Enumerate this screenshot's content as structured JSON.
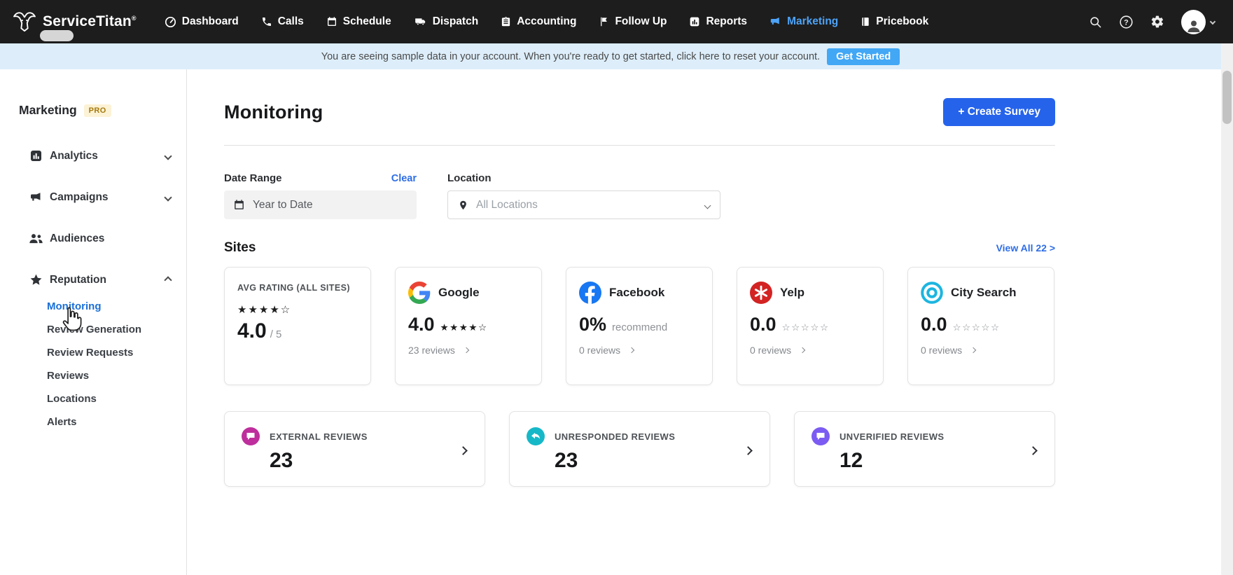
{
  "topbar": {
    "brand": "ServiceTitan",
    "brand_reg": "®",
    "nav": [
      {
        "label": "Dashboard",
        "active": false
      },
      {
        "label": "Calls",
        "active": false
      },
      {
        "label": "Schedule",
        "active": false
      },
      {
        "label": "Dispatch",
        "active": false
      },
      {
        "label": "Accounting",
        "active": false
      },
      {
        "label": "Follow Up",
        "active": false
      },
      {
        "label": "Reports",
        "active": false
      },
      {
        "label": "Marketing",
        "active": true
      },
      {
        "label": "Pricebook",
        "active": false
      }
    ]
  },
  "banner": {
    "message_pre": "You are seeing sample data in your account. When you're ready to get started, ",
    "link_text": "click here",
    "message_post": " to reset your account.",
    "button_label": "Get Started"
  },
  "sidebar": {
    "title": "Marketing",
    "badge": "PRO",
    "items": [
      {
        "label": "Analytics",
        "expandable": true
      },
      {
        "label": "Campaigns",
        "expandable": true
      },
      {
        "label": "Audiences",
        "expandable": false
      },
      {
        "label": "Reputation",
        "expandable": true,
        "expanded": true
      }
    ],
    "reputation_children": [
      {
        "label": "Monitoring",
        "active": true
      },
      {
        "label": "Review Generation",
        "active": false
      },
      {
        "label": "Review Requests",
        "active": false
      },
      {
        "label": "Reviews",
        "active": false
      },
      {
        "label": "Locations",
        "active": false
      },
      {
        "label": "Alerts",
        "active": false
      }
    ]
  },
  "main": {
    "title": "Monitoring",
    "create_survey_label": "+ Create Survey",
    "filters": {
      "date_range_label": "Date Range",
      "clear_label": "Clear",
      "date_value": "Year to Date",
      "location_label": "Location",
      "location_value": "All Locations"
    },
    "sites": {
      "heading": "Sites",
      "view_all_label": "View All 22 >",
      "avg_card": {
        "label": "AVG RATING (ALL SITES)",
        "stars": "★★★★☆",
        "rating": "4.0",
        "rating_suffix": "/ 5"
      },
      "site_cards": [
        {
          "name": "Google",
          "rating": "4.0",
          "stars": "★★★★☆",
          "reviews": "23 reviews"
        },
        {
          "name": "Facebook",
          "rating": "0%",
          "note": "recommend",
          "reviews": "0 reviews"
        },
        {
          "name": "Yelp",
          "rating": "0.0",
          "stars": "☆☆☆☆☆",
          "reviews": "0 reviews"
        },
        {
          "name": "City Search",
          "rating": "0.0",
          "stars": "☆☆☆☆☆",
          "reviews": "0 reviews"
        }
      ]
    },
    "summary_cards": [
      {
        "label": "EXTERNAL REVIEWS",
        "value": "23"
      },
      {
        "label": "UNRESPONDED REVIEWS",
        "value": "23"
      },
      {
        "label": "UNVERIFIED REVIEWS",
        "value": "12"
      }
    ]
  },
  "icons": {
    "topbar": [
      "goat-logo",
      "dashboard-gauge",
      "phone",
      "calendar",
      "truck",
      "clipboard",
      "flag",
      "bar-chart",
      "megaphone",
      "book",
      "search",
      "help-circle",
      "gear",
      "avatar-person",
      "chevron-down"
    ],
    "sidebar": [
      "bar-chart-square",
      "megaphone",
      "people",
      "star",
      "chevron-down",
      "chevron-up"
    ],
    "cards": [
      "google-g",
      "facebook-f",
      "yelp-burst",
      "citysearch-rings",
      "speech-bubble",
      "reply-arrow"
    ],
    "other": [
      "calendar-dark",
      "location-pin",
      "hand-cursor"
    ]
  },
  "colors": {
    "topbar_bg": "#1d1d1d",
    "active_nav_blue": "#4da3f7",
    "banner_bg": "#ddeefa",
    "banner_button_blue": "#42a7f5",
    "primary_button_blue": "#2563eb",
    "link_blue": "#2e6de5",
    "active_sidebar_blue": "#1b6fd6",
    "pro_badge_bg": "#fcf2d5",
    "pro_badge_text": "#a5790e",
    "facebook_blue": "#1877f2",
    "yelp_red": "#d32323",
    "citysearch_teal": "#1cb5e0",
    "external_reviews_icon": "#be2e9c",
    "unresponded_reviews_icon": "#16b8c8",
    "unverified_reviews_icon": "#7b5bf2"
  }
}
